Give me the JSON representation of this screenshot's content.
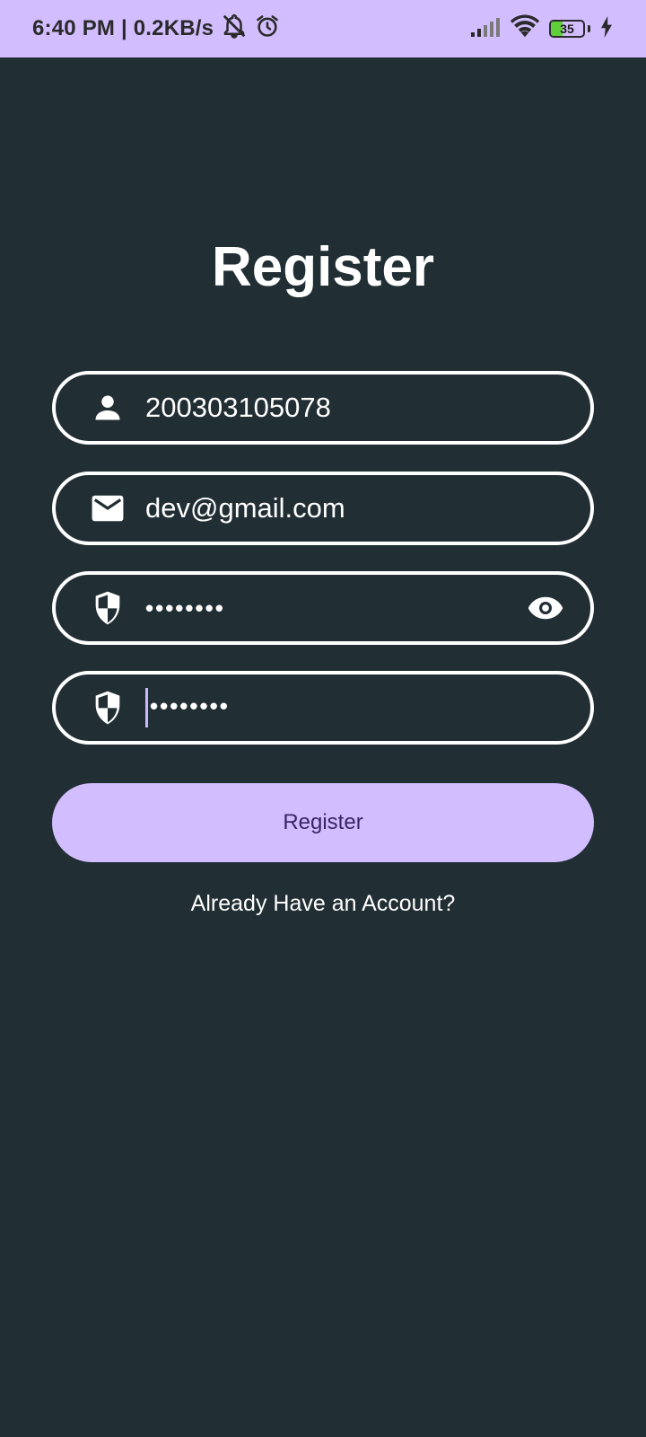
{
  "status_bar": {
    "time_speed": "6:40 PM | 0.2KB/s",
    "battery_level": "35",
    "battery_fraction": 0.35,
    "icons": [
      "muted-bell-icon",
      "alarm-icon",
      "signal-icon",
      "wifi-icon",
      "battery-icon",
      "charging-icon"
    ]
  },
  "page": {
    "title": "Register"
  },
  "form": {
    "username": {
      "value": "200303105078",
      "icon": "person-icon"
    },
    "email": {
      "value": "dev@gmail.com",
      "icon": "mail-icon"
    },
    "password": {
      "value": "••••••••",
      "icon": "shield-icon",
      "toggle_icon": "eye-icon"
    },
    "confirm_password": {
      "value": "••••••••",
      "icon": "shield-icon"
    }
  },
  "actions": {
    "register_label": "Register",
    "login_link": "Already Have an Account?"
  },
  "colors": {
    "background": "#212e34",
    "accent": "#d2bdff",
    "button_text": "#3a2566",
    "field_border": "#ffffff"
  }
}
